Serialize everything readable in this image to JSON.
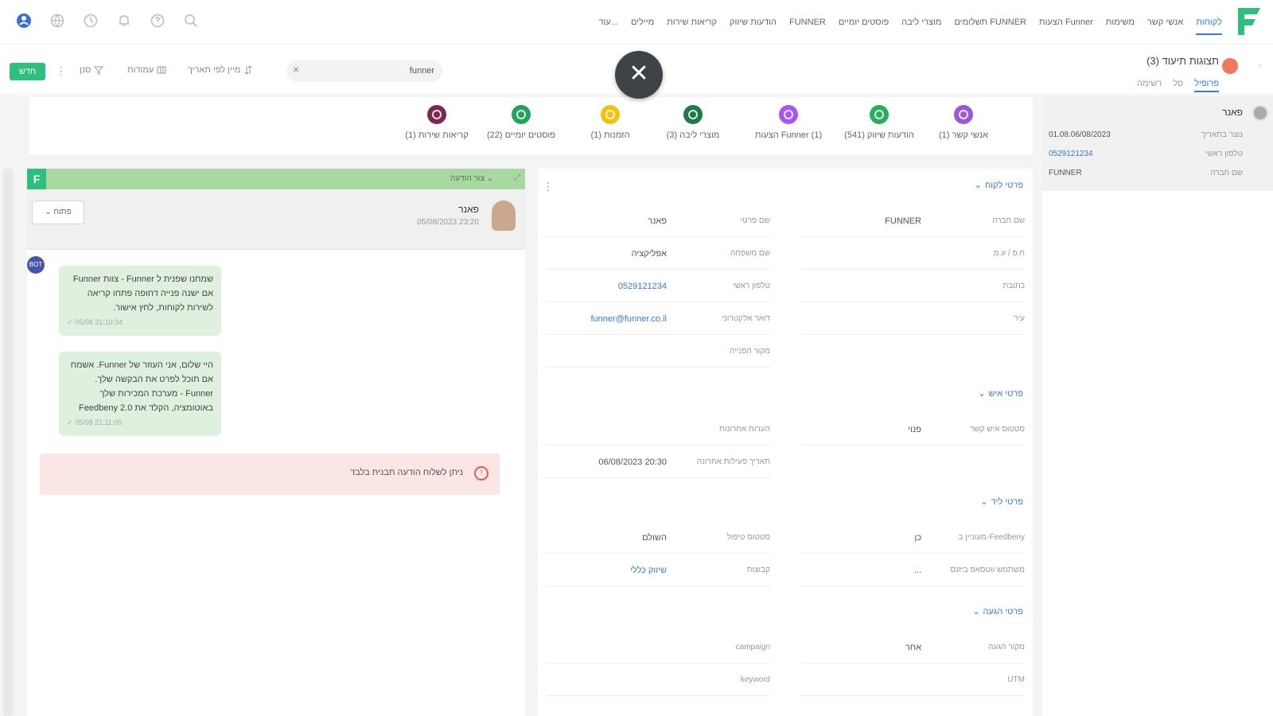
{
  "nav": {
    "items": [
      {
        "label": "לקוחות",
        "active": true
      },
      {
        "label": "אנשי קשר",
        "active": false
      },
      {
        "label": "משימות",
        "active": false
      },
      {
        "label": "הצעות Funner",
        "active": false
      },
      {
        "label": "תשלומים FUNNER",
        "active": false
      },
      {
        "label": "מוצרי ליבה",
        "active": false
      },
      {
        "label": "פוסטים יומיים",
        "active": false
      },
      {
        "label": "FUNNER",
        "active": false
      },
      {
        "label": "הודעות שיווק",
        "active": false
      },
      {
        "label": "קריאות שירות",
        "active": false
      },
      {
        "label": "מיילים",
        "active": false
      },
      {
        "label": "עוד...",
        "active": false
      }
    ],
    "icons": [
      "user-icon",
      "globe-icon",
      "clock-icon",
      "bell-icon",
      "help-icon",
      "search-icon"
    ],
    "accent": "#3a78e0"
  },
  "toolbar": {
    "new_label": "חדש",
    "columns_label": "עמודות",
    "filter_label": "סנן",
    "sort_label": "מיין לפי תאריך",
    "search_value": "funner",
    "title": "תצוגות תיעוד (3)",
    "subtabs": [
      {
        "label": "פרופיל",
        "active": true
      },
      {
        "label": "סל",
        "active": false
      },
      {
        "label": "רשימה",
        "active": false
      }
    ]
  },
  "info_panel": {
    "name": "פאנר",
    "rows": [
      {
        "label": "נוצר בתאריך",
        "value": "01.08.06/08/2023",
        "link": false
      },
      {
        "label": "טלפון ראשי",
        "value": "0529121234",
        "link": true
      },
      {
        "label": "שם חברה",
        "value": "FUNNER",
        "link": false
      }
    ]
  },
  "status_bar": {
    "items": [
      {
        "label": "אנשי קשר (1)",
        "color": "#9b59d6"
      },
      {
        "label": "הודעות שיווק (541)",
        "color": "#27ae60"
      },
      {
        "label": "הצעות Funner (1)",
        "color": "#a855f7"
      },
      {
        "label": "מוצרי ליבה (3)",
        "color": "#1e7a4a"
      },
      {
        "label": "הזמנות (1)",
        "color": "#f4c20d"
      },
      {
        "label": "פוסטים יומיים (22)",
        "color": "#22a35a"
      },
      {
        "label": "קריאות שירות (1)",
        "color": "#7a2a4e"
      }
    ]
  },
  "chat": {
    "header_text": "צור הודעה ⌄",
    "contact_name": "פאנר",
    "contact_date": "05/08/2023 23:20",
    "status_button": "פתוח",
    "bot_label": "BOT",
    "messages": [
      {
        "text": "שמחנו שפנית ל Funner - צוות Funner אם ישנה פנייה דחופה פתחו קריאה לשירות לקוחות, לחץ אישור.",
        "time": "05/08 21:10:34"
      },
      {
        "text": "היי שלום, אני העוזר של Funner. אשמח אם תוכל לפרט את הבקשה שלך. Funner - מערכת המכירות שלך באוטומציה, הקלד את Feedbeny 2.0",
        "time": "05/08 21:11:05"
      }
    ],
    "error_text": "ניתן לשלוח הודעה תבנית בלבד",
    "error_color": "#e25b5b"
  },
  "details": {
    "sections": [
      {
        "title": "פרטי לקוח"
      },
      {
        "title": "פרטי איש"
      },
      {
        "title": "פרטי ליד"
      },
      {
        "title": "פרטי הגעה"
      }
    ],
    "customer": {
      "right": [
        {
          "label": "שם חברה",
          "value": "FUNNER"
        },
        {
          "label": "ח.פ / ע.מ",
          "value": ""
        },
        {
          "label": "כתובת",
          "value": ""
        },
        {
          "label": "עיר",
          "value": ""
        }
      ],
      "left": [
        {
          "label": "שם פרטי",
          "value": "פאנר",
          "link": false
        },
        {
          "label": "שם משפחה",
          "value": "אפליקציה",
          "link": false
        },
        {
          "label": "טלפון ראשי",
          "value": "0529121234",
          "link": true
        },
        {
          "label": "דואר אלקטרוני",
          "value": "funner@funner.co.il",
          "link": true
        },
        {
          "label": "מקור הפנייה",
          "value": "",
          "link": false
        }
      ]
    },
    "contact": {
      "right": [
        {
          "label": "סטטוס איש קשר",
          "value": "פנוי"
        }
      ],
      "left": [
        {
          "label": "הערות אחרונות",
          "value": "",
          "link": false
        },
        {
          "label": "תאריך פעילות אחרונה",
          "value": "06/08/2023 20:30",
          "link": false
        }
      ]
    },
    "lead": {
      "right": [
        {
          "label": "מעוניין ב-Feedbeny",
          "value": "כן"
        },
        {
          "label": "משתמש ווטסאפ ביזנס",
          "value": "..."
        }
      ],
      "left": [
        {
          "label": "סטטוס טיפול",
          "value": "השולם",
          "link": false
        },
        {
          "label": "קבוצות",
          "value": "שיווק כללי",
          "link": true
        }
      ]
    },
    "arrival": {
      "right": [
        {
          "label": "מקור הגעה",
          "value": "אחר"
        },
        {
          "label": "UTM",
          "value": ""
        }
      ],
      "left": [
        {
          "label": "campaign",
          "value": "",
          "link": false
        },
        {
          "label": "keyword",
          "value": "",
          "link": false
        }
      ]
    }
  }
}
